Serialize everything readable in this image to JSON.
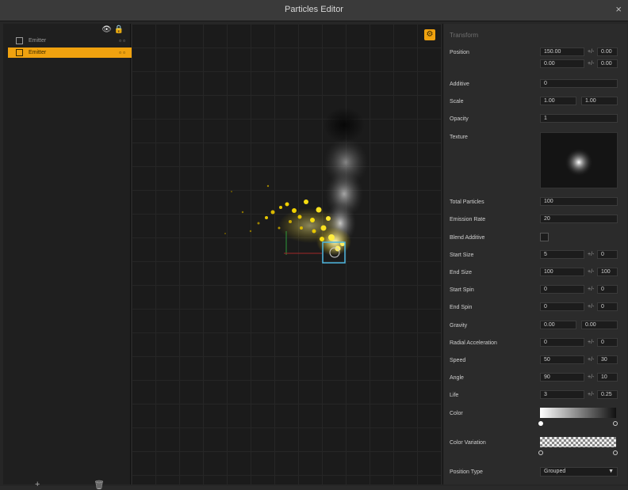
{
  "window": {
    "title": "Particles Editor",
    "close_glyph": "×"
  },
  "left": {
    "header_icons": [
      "eye-icon",
      "lock-icon"
    ],
    "header_glyphs": "👁 🔒",
    "layers": [
      {
        "label": "Emitter",
        "ctrl": "▫ ▫",
        "selected": false
      },
      {
        "label": "Emitter",
        "ctrl": "▫ ▫",
        "selected": true
      }
    ],
    "footer": {
      "add": "+",
      "delete": "🗑"
    }
  },
  "viewport": {
    "gear_glyph": "⚙"
  },
  "inspector": {
    "title": "Transform",
    "labels": {
      "position": "Position",
      "additive": "Additive",
      "scale": "Scale",
      "opacity": "Opacity",
      "texture": "Texture",
      "total_particles": "Total Particles",
      "emission_rate": "Emission Rate",
      "blend_additive": "Blend Additive",
      "start_size": "Start Size",
      "end_size": "End Size",
      "start_spin": "Start Spin",
      "end_spin": "End Spin",
      "gravity": "Gravity",
      "radial_accel": "Radial Acceleration",
      "speed": "Speed",
      "angle": "Angle",
      "life": "Life",
      "color": "Color",
      "color_variation": "Color Variation",
      "position_type": "Position Type"
    },
    "values": {
      "pos_x": "150.00",
      "pos_x_var": "0.00",
      "pos_y": "0.00",
      "pos_y_var": "0.00",
      "additive": "0",
      "scale_x": "1.00",
      "scale_y": "1.00",
      "opacity": "1",
      "total_particles": "100",
      "emission_rate": "20",
      "start_size": "5",
      "start_size_var": "0",
      "end_size": "100",
      "end_size_var": "100",
      "start_spin": "0",
      "start_spin_var": "0",
      "end_spin": "0",
      "end_spin_var": "0",
      "gravity_x": "0.00",
      "gravity_y": "0.00",
      "radial_accel": "0",
      "radial_accel_var": "0",
      "speed": "50",
      "speed_var": "30",
      "angle": "90",
      "angle_var": "10",
      "life": "3",
      "life_var": "0.25",
      "position_type": "Grouped"
    },
    "sep": "+/-"
  },
  "colors": {
    "accent": "#f0a20f",
    "gizmo": "#4fb8e0"
  }
}
